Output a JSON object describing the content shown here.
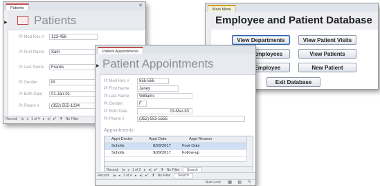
{
  "patients": {
    "tab": "Patients",
    "title": "Patients",
    "fields": [
      {
        "label": "Pt Med Rec #",
        "value": "123-456"
      },
      {
        "label": "Pt First Name",
        "value": "Sam"
      },
      {
        "label": "Pt Last Name",
        "value": "Franks"
      },
      {
        "label": "Pt Gender",
        "value": "M"
      },
      {
        "label": "Pt Birth Date",
        "value": "01-Jan-01"
      },
      {
        "label": "Pt Phone #",
        "value": "(352) 555-1234"
      }
    ],
    "nav": {
      "record": "Record:",
      "position": "1 of 4",
      "filter": "No Filter",
      "status": "Num Lock"
    }
  },
  "appointments": {
    "tab": "Patient Appointments",
    "title": "Patient Appointments",
    "fields": [
      {
        "label": "Pt Med Rec #",
        "value": "555-555"
      },
      {
        "label": "Pt First Name",
        "value": "Janey"
      },
      {
        "label": "Pt Last Name",
        "value": "Williams"
      },
      {
        "label": "Pt Gender",
        "value": "F"
      },
      {
        "label": "Pt Birth Date",
        "value": "03-Mar-83"
      },
      {
        "label": "Pt Phone #",
        "value": "(352) 555-5555"
      }
    ],
    "section_label": "Appointments",
    "columns": [
      "Appt Doctor",
      "Appt Date",
      "Appt Reason"
    ],
    "rows": [
      [
        "Scholls",
        "8/29/2017",
        "Foot Odor"
      ],
      [
        "Scholls",
        "9/29/2017",
        "Follow-up"
      ]
    ],
    "subnav": {
      "record": "Record:",
      "position": "1 of 2",
      "filter": "No Filter",
      "search": "Search"
    },
    "nav": {
      "record": "Record:",
      "position": "2 of 4",
      "filter": "No Filter",
      "search": "Search"
    },
    "status": "Num Lock"
  },
  "main_menu": {
    "tab": "Main Menu",
    "title": "Employee and Patient Database",
    "buttons": {
      "view_departments": "View Departments",
      "view_patient_visits": "View Patient Visits",
      "view_employees": "View Employees",
      "view_patients": "View Patients",
      "new_employee": "New Employee",
      "new_patient": "New Patient",
      "exit_database": "Exit Database"
    }
  }
}
